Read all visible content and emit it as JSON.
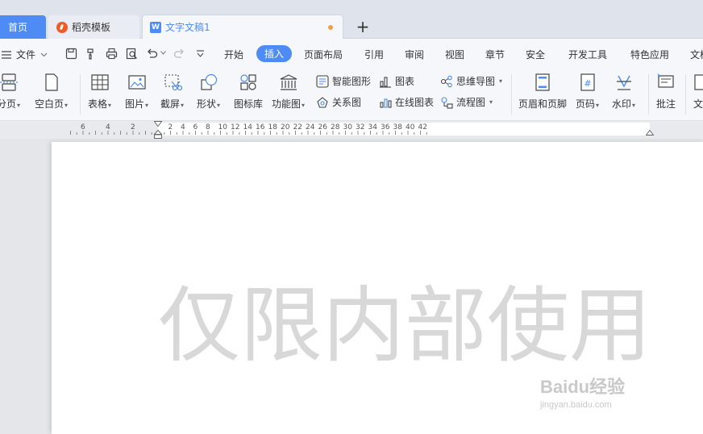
{
  "tabs": {
    "home": "首页",
    "daoke": "稻壳模板",
    "document": "文字文稿1",
    "new_tab": "+"
  },
  "menu": {
    "file": "文件",
    "items": [
      "开始",
      "插入",
      "页面布局",
      "引用",
      "审阅",
      "视图",
      "章节",
      "安全",
      "开发工具",
      "特色应用",
      "文档"
    ],
    "active": "插入"
  },
  "ribbon": {
    "page_break": "分页",
    "blank_page": "空白页",
    "table": "表格",
    "picture": "图片",
    "screenshot": "截屏",
    "shapes": "形状",
    "icon_library": "图标库",
    "function_chart": "功能图",
    "smart_graphic": "智能图形",
    "chart": "图表",
    "mind_map": "思维导图",
    "relationship": "关系图",
    "online_chart": "在线图表",
    "flowchart": "流程图",
    "header_footer": "页眉和页脚",
    "page_number": "页码",
    "watermark": "水印",
    "comment": "批注",
    "textbox": "文"
  },
  "ruler": {
    "left_labels": [
      "6",
      "4",
      "2"
    ],
    "right_labels": [
      "2",
      "4",
      "6",
      "8",
      "10",
      "12",
      "14",
      "16",
      "18",
      "20",
      "22",
      "24",
      "26",
      "28",
      "30",
      "32",
      "34",
      "36",
      "38",
      "40",
      "42"
    ]
  },
  "document": {
    "watermark_text": "仅限内部使用"
  },
  "overlay": {
    "brand": "Baidu经验",
    "url": "jingyan.baidu.com"
  },
  "colors": {
    "accent": "#4e8bf5",
    "watermark": "#d8d8d8",
    "unsaved": "#f0a046"
  }
}
